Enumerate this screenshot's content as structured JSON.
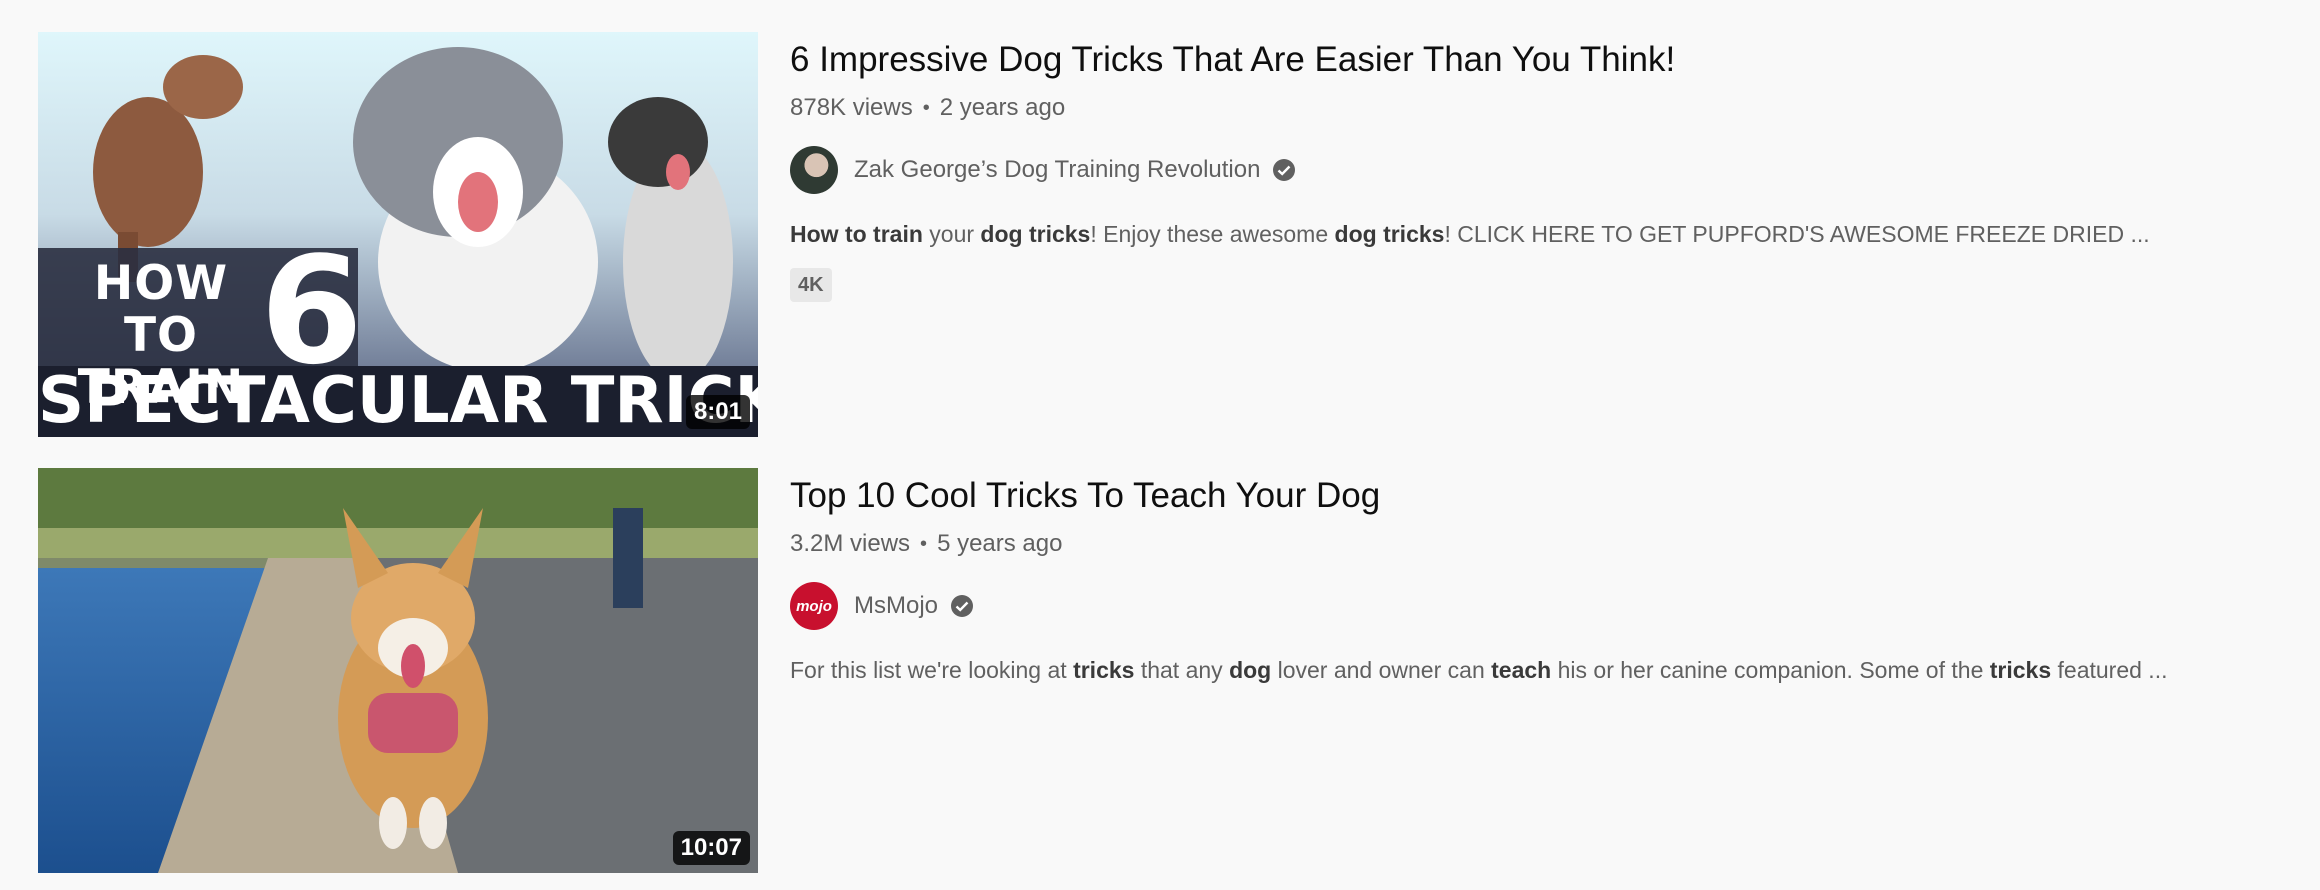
{
  "results": [
    {
      "title": "6 Impressive Dog Tricks That Are Easier Than You Think!",
      "views": "878K views",
      "age": "2 years ago",
      "separator": "•",
      "duration": "8:01",
      "thumbnail_text": {
        "line1": "HOW TO",
        "line2": "TRAIN",
        "number": "6",
        "line3": "SPECTACULAR TRICKS"
      },
      "channel": {
        "name": "Zak George’s Dog Training Revolution",
        "avatar_icon": "channel-avatar",
        "verified_icon": "verified-check-icon"
      },
      "description": [
        {
          "text": "How to train",
          "bold": true
        },
        {
          "text": " your ",
          "bold": false
        },
        {
          "text": "dog tricks",
          "bold": true
        },
        {
          "text": "! Enjoy these awesome ",
          "bold": false
        },
        {
          "text": "dog tricks",
          "bold": true
        },
        {
          "text": "! CLICK HERE TO GET PUPFORD'S AWESOME FREEZE DRIED ...",
          "bold": false
        }
      ],
      "badge": "4K"
    },
    {
      "title": "Top 10 Cool Tricks To Teach Your Dog",
      "views": "3.2M views",
      "age": "5 years ago",
      "separator": "•",
      "duration": "10:07",
      "channel": {
        "name": "MsMojo",
        "avatar_text": "mojo",
        "verified_icon": "verified-check-icon"
      },
      "description": [
        {
          "text": "For this list we're looking at ",
          "bold": false
        },
        {
          "text": "tricks",
          "bold": true
        },
        {
          "text": " that any ",
          "bold": false
        },
        {
          "text": "dog",
          "bold": true
        },
        {
          "text": " lover and owner can ",
          "bold": false
        },
        {
          "text": "teach",
          "bold": true
        },
        {
          "text": " his or her canine companion. Some of the ",
          "bold": false
        },
        {
          "text": "tricks",
          "bold": true
        },
        {
          "text": " featured ...",
          "bold": false
        }
      ]
    }
  ],
  "colors": {
    "background": "#f9f9f9",
    "title": "#0f0f0f",
    "secondary": "#606060",
    "mojo_red": "#c8102e"
  }
}
